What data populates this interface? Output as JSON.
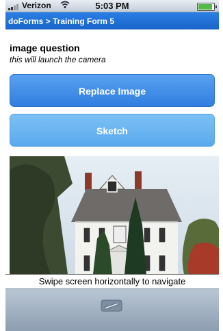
{
  "status": {
    "carrier": "Verizon",
    "time": "5:03 PM",
    "battery_level": 1.0,
    "icons": [
      "signal-icon",
      "wifi-icon",
      "battery-icon"
    ]
  },
  "titlebar": {
    "title": "doForms > Training Form 5"
  },
  "question": {
    "title": "image question",
    "hint": "this will launch the camera"
  },
  "buttons": {
    "replace": "Replace Image",
    "sketch": "Sketch"
  },
  "footer": {
    "swipe_hint": "Swipe screen horizontally to navigate",
    "icon": "sketch-pen-icon"
  },
  "colors": {
    "accent": "#1a64c8",
    "button_primary": "#3c88e6",
    "button_secondary": "#6db5f2"
  }
}
